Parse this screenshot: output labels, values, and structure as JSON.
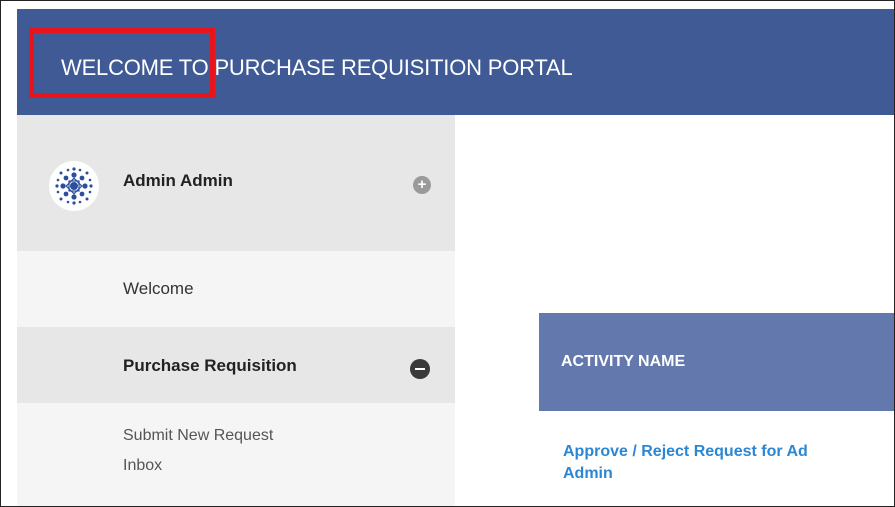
{
  "header": {
    "title": "WELCOME TO PURCHASE REQUISITION PORTAL",
    "background": "#3f5a94",
    "highlight_color": "#e8141b"
  },
  "profile": {
    "name": "Admin Admin",
    "expand_icon": "plus-circle-icon",
    "avatar_icon": "logo-avatar"
  },
  "sidebar": {
    "items": [
      {
        "label": "Welcome"
      },
      {
        "label": "Purchase Requisition",
        "icon": "minus-circle-icon"
      }
    ],
    "subitems": [
      {
        "label": "Submit New Request"
      },
      {
        "label": "Inbox"
      }
    ]
  },
  "table": {
    "header": "ACTIVITY NAME",
    "header_color": "#6378ad",
    "rows": [
      {
        "line1": "Approve / Reject Request for Ad",
        "line2": "Admin"
      }
    ],
    "link_color": "#2b87d4"
  }
}
